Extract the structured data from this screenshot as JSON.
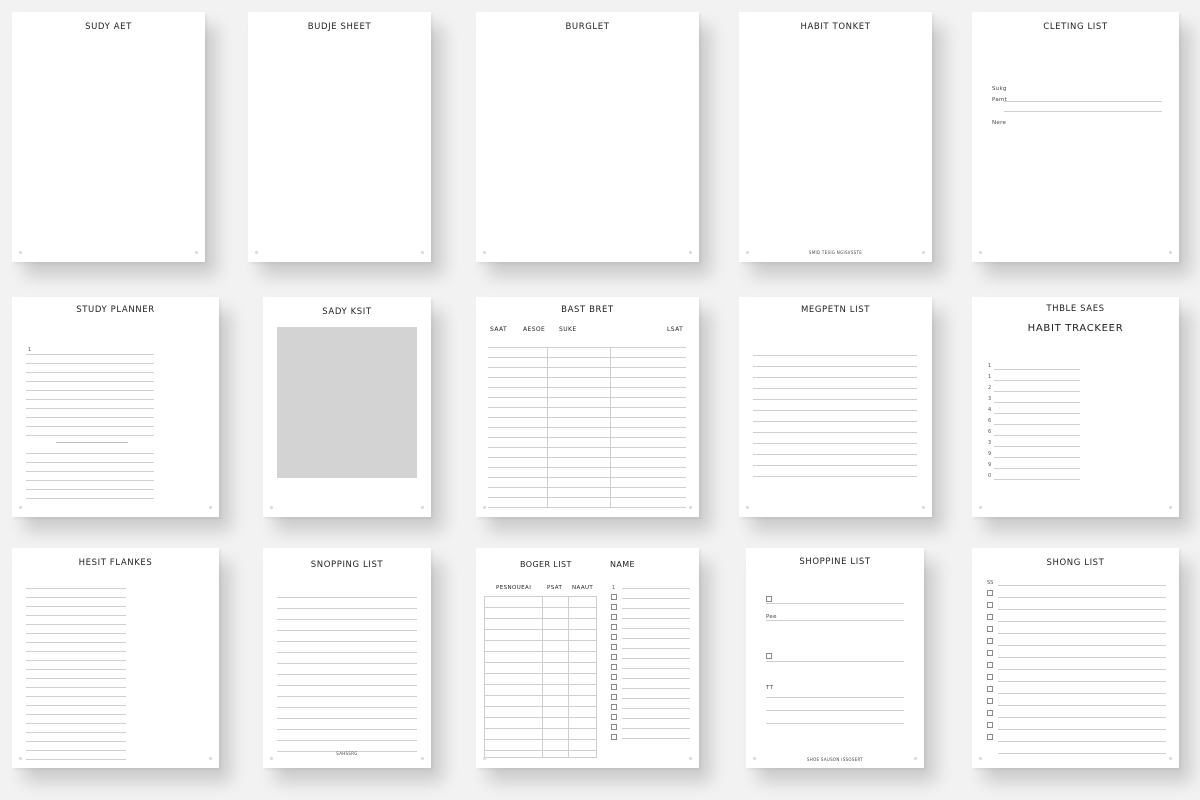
{
  "sheets": {
    "s1": {
      "title": "SUDY AET"
    },
    "s2": {
      "title": "BUDJE SHEET"
    },
    "s3": {
      "title": "BURGLET"
    },
    "s4": {
      "title": "HABIT TONKET",
      "footer": "SMID TESIG NGISVSSTE"
    },
    "s5": {
      "title": "CLETING LIST",
      "labels": [
        "Sukg",
        "Pamt",
        "Nere"
      ]
    },
    "s6": {
      "title": "STUDY PLANNER",
      "marker": "1"
    },
    "s7": {
      "title": "SADY KSIT"
    },
    "s8": {
      "title": "BAST BRET",
      "cols": [
        "SAAT",
        "AESOE",
        "SUKE",
        "LSAT"
      ]
    },
    "s9": {
      "title": "MEGPETN LIST"
    },
    "s10": {
      "title": "THBLE SAES",
      "subtitle": "HABIT TRACKEER",
      "numbers": [
        "1",
        "1",
        "2",
        "3",
        "4",
        "6",
        "6",
        "3",
        "9",
        "9",
        "0"
      ]
    },
    "s11": {
      "title": "HESIT FLANKES"
    },
    "s12": {
      "title": "SNOPPING LIST",
      "footer": "SAHSSRG"
    },
    "s13": {
      "title": "BOGER LIST",
      "title_right": "NAME",
      "cols": [
        "PESNOUEAI",
        "PSAT",
        "NAAUT"
      ],
      "side_label": "1"
    },
    "s14": {
      "title": "SHOPPINE LIST",
      "labels": [
        "Pee",
        "TT"
      ],
      "footer": "SHOE SAUSON ISSOSERT"
    },
    "s15": {
      "title": "SHONG LIST",
      "label": "SS"
    }
  },
  "colors": {
    "background": "#f2f2f2",
    "sheet": "#ffffff",
    "rule": "#cfcfcf",
    "photo": "#d3d3d3"
  }
}
